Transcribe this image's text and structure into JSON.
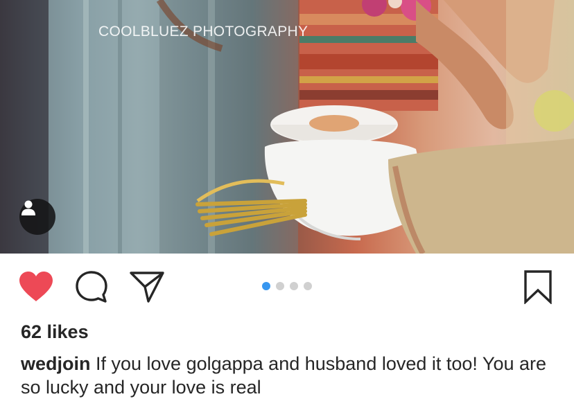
{
  "photo": {
    "watermark": "COOLBLUEZ PHOTOGRAPHY"
  },
  "post": {
    "likes_text": "62 likes",
    "username": "wedjoin",
    "caption": " If you love golgappa and husband loved it too! You are so lucky and your love is real"
  },
  "carousel": {
    "count": 4,
    "active_index": 0
  },
  "colors": {
    "like_red": "#ed4956",
    "carousel_active": "#3897f0",
    "carousel_inactive": "#d0d0d0",
    "icon_stroke": "#262626",
    "text": "#262626"
  },
  "icons": {
    "like": "heart-icon",
    "comment": "comment-bubble-icon",
    "share": "paper-plane-icon",
    "save": "bookmark-icon",
    "tag": "user-icon"
  }
}
